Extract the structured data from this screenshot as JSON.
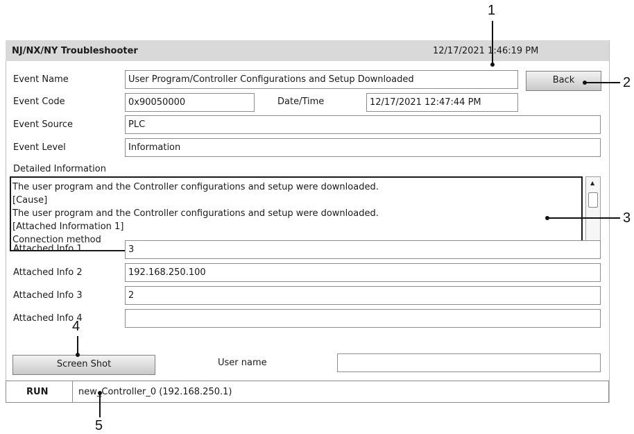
{
  "header": {
    "title": "NJ/NX/NY Troubleshooter",
    "datetime": "12/17/2021 1:46:19 PM"
  },
  "event": {
    "name_label": "Event Name",
    "name_value": "User Program/Controller Configurations and Setup Downloaded",
    "code_label": "Event Code",
    "code_value": "0x90050000",
    "datetime_label": "Date/Time",
    "datetime_value": "12/17/2021 12:47:44 PM",
    "source_label": "Event Source",
    "source_value": "PLC",
    "level_label": "Event Level",
    "level_value": "Information"
  },
  "back_button": "Back",
  "detailed": {
    "label": "Detailed Information",
    "lines": [
      "The user program and the Controller configurations and setup were downloaded.",
      "[Cause]",
      "The user program and the Controller configurations and setup were downloaded.",
      "[Attached Information 1]",
      "Connection method"
    ]
  },
  "attached": [
    {
      "label": "Attached Info 1",
      "value": "3"
    },
    {
      "label": "Attached Info 2",
      "value": "192.168.250.100"
    },
    {
      "label": "Attached Info 3",
      "value": "2"
    },
    {
      "label": "Attached Info 4",
      "value": ""
    }
  ],
  "screenshot_button": "Screen Shot",
  "user_name": {
    "label": "User name",
    "value": ""
  },
  "status": {
    "mode": "RUN",
    "controller": "new_Controller_0 (192.168.250.1)"
  },
  "callouts": [
    "1",
    "2",
    "3",
    "4",
    "5"
  ],
  "icons": {
    "scroll_up": "triangle-up-icon",
    "scroll_down": "triangle-down-icon"
  }
}
